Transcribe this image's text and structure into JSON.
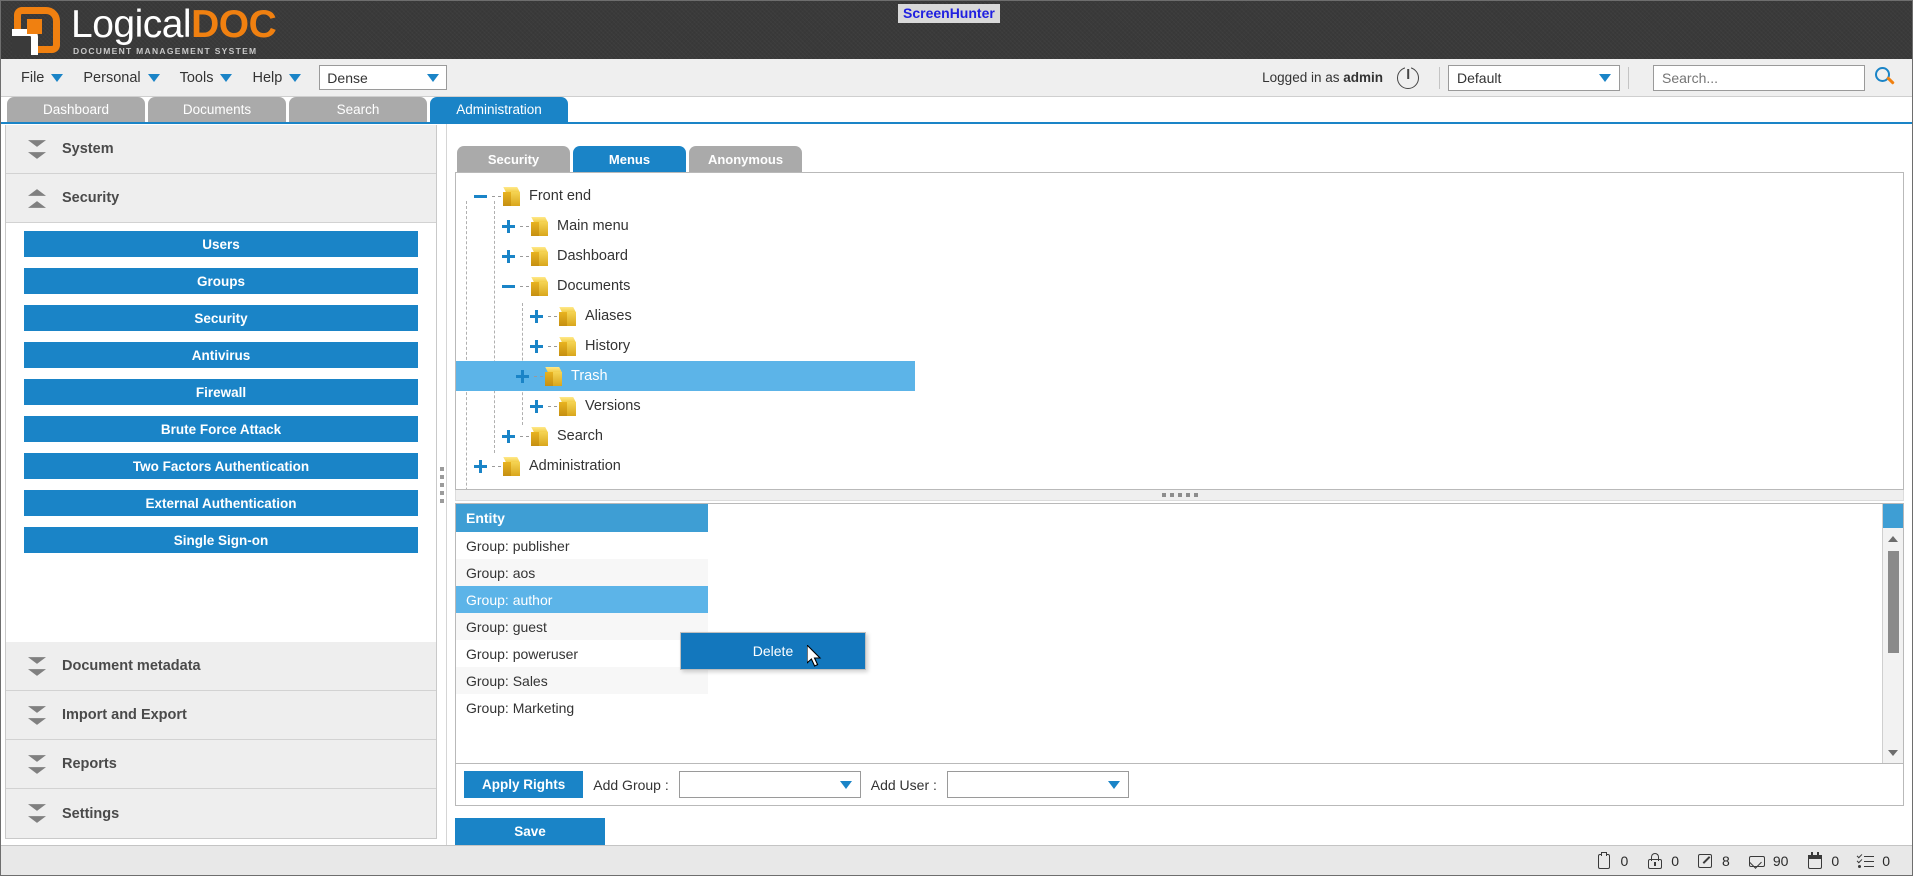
{
  "watermark": "ScreenHunter",
  "logo": {
    "part1": "Logical",
    "part2": "DOC",
    "tagline": "DOCUMENT MANAGEMENT SYSTEM"
  },
  "menubar": {
    "items": [
      "File",
      "Personal",
      "Tools",
      "Help"
    ],
    "density_value": "Dense",
    "logged_in_prefix": "Logged in as ",
    "logged_in_user": "admin",
    "profile_value": "Default",
    "search_placeholder": "Search..."
  },
  "tabs": [
    {
      "label": "Dashboard",
      "active": false
    },
    {
      "label": "Documents",
      "active": false
    },
    {
      "label": "Search",
      "active": false
    },
    {
      "label": "Administration",
      "active": true
    }
  ],
  "sidebar": {
    "sections": [
      {
        "label": "System",
        "expanded": false
      },
      {
        "label": "Security",
        "expanded": true
      },
      {
        "label": "Document metadata",
        "expanded": false
      },
      {
        "label": "Import and Export",
        "expanded": false
      },
      {
        "label": "Reports",
        "expanded": false
      },
      {
        "label": "Settings",
        "expanded": false
      }
    ],
    "security_buttons": [
      "Users",
      "Groups",
      "Security",
      "Antivirus",
      "Firewall",
      "Brute Force Attack",
      "Two Factors Authentication",
      "External Authentication",
      "Single Sign-on"
    ]
  },
  "subtabs": [
    {
      "label": "Security",
      "active": false
    },
    {
      "label": "Menus",
      "active": true
    },
    {
      "label": "Anonymous",
      "active": false
    }
  ],
  "tree": [
    {
      "label": "Front end",
      "depth": 0,
      "toggle": "minus",
      "selected": false
    },
    {
      "label": "Main menu",
      "depth": 1,
      "toggle": "plus",
      "selected": false
    },
    {
      "label": "Dashboard",
      "depth": 1,
      "toggle": "plus",
      "selected": false
    },
    {
      "label": "Documents",
      "depth": 1,
      "toggle": "minus",
      "selected": false
    },
    {
      "label": "Aliases",
      "depth": 2,
      "toggle": "plus",
      "selected": false
    },
    {
      "label": "History",
      "depth": 2,
      "toggle": "plus",
      "selected": false
    },
    {
      "label": "Trash",
      "depth": 2,
      "toggle": "plus",
      "selected": true
    },
    {
      "label": "Versions",
      "depth": 2,
      "toggle": "plus",
      "selected": false
    },
    {
      "label": "Search",
      "depth": 1,
      "toggle": "plus",
      "selected": false
    },
    {
      "label": "Administration",
      "depth": 0,
      "toggle": "plus",
      "selected": false
    }
  ],
  "grid": {
    "header": "Entity",
    "rows": [
      {
        "label": "Group: publisher",
        "selected": false
      },
      {
        "label": "Group: aos",
        "selected": false
      },
      {
        "label": "Group: author",
        "selected": true
      },
      {
        "label": "Group: guest",
        "selected": false
      },
      {
        "label": "Group: poweruser",
        "selected": false
      },
      {
        "label": "Group: Sales",
        "selected": false
      },
      {
        "label": "Group: Marketing",
        "selected": false
      }
    ]
  },
  "context_menu": {
    "delete_label": "Delete"
  },
  "toolbar": {
    "apply_rights_label": "Apply Rights",
    "add_group_label": "Add Group :",
    "add_group_value": "",
    "add_user_label": "Add User :",
    "add_user_value": "",
    "save_label": "Save"
  },
  "statusbar": [
    {
      "icon": "clipboard-icon",
      "count": "0"
    },
    {
      "icon": "lock-icon",
      "count": "0"
    },
    {
      "icon": "edit-icon",
      "count": "8"
    },
    {
      "icon": "mail-icon",
      "count": "90"
    },
    {
      "icon": "calendar-icon",
      "count": "0"
    },
    {
      "icon": "task-icon",
      "count": "0"
    }
  ],
  "colors": {
    "accent": "#1a84c7",
    "selection": "#5cb4e8",
    "header": "#3e9ed4",
    "brand_orange": "#f08010"
  }
}
